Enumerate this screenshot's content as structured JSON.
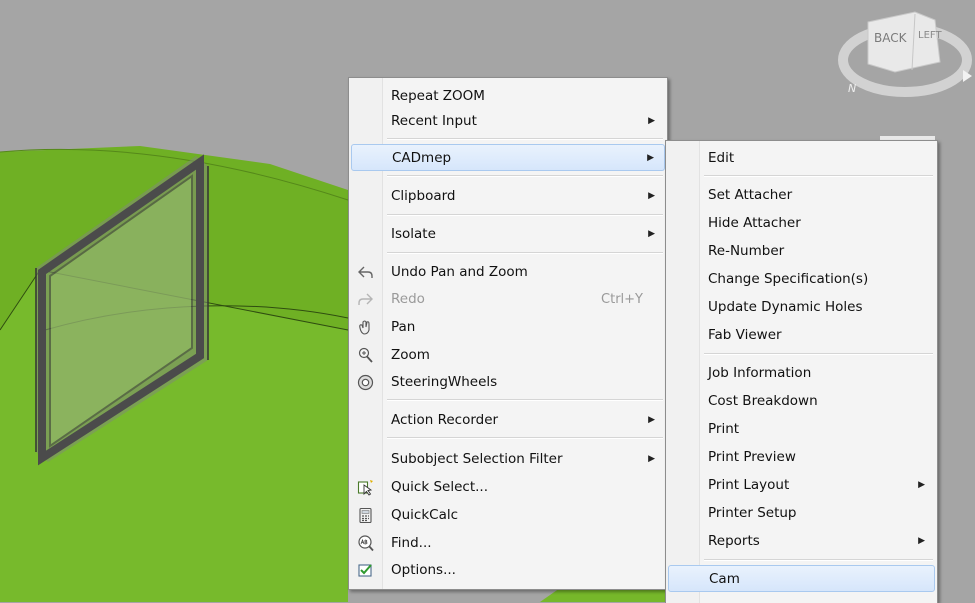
{
  "viewcube": {
    "face_back": "BACK",
    "face_left": "LEFT",
    "compass_n": "N"
  },
  "context_menu": {
    "items": [
      {
        "label": "Repeat ZOOM"
      },
      {
        "label": "Recent Input"
      },
      {
        "label": "CADmep"
      },
      {
        "label": "Clipboard"
      },
      {
        "label": "Isolate"
      },
      {
        "label": "Undo Pan and Zoom",
        "icon": "undo-icon"
      },
      {
        "label": "Redo",
        "icon": "redo-icon",
        "shortcut": "Ctrl+Y",
        "disabled": true
      },
      {
        "label": "Pan",
        "icon": "pan-hand-icon"
      },
      {
        "label": "Zoom",
        "icon": "zoom-magnifier-icon"
      },
      {
        "label": "SteeringWheels",
        "icon": "steering-wheel-icon"
      },
      {
        "label": "Action Recorder"
      },
      {
        "label": "Subobject Selection Filter"
      },
      {
        "label": "Quick Select...",
        "icon": "quick-select-icon"
      },
      {
        "label": "QuickCalc",
        "icon": "calculator-icon"
      },
      {
        "label": "Find...",
        "icon": "find-abc-icon"
      },
      {
        "label": "Options...",
        "icon": "options-checkbox-icon"
      }
    ]
  },
  "cadmep_submenu": {
    "items": [
      {
        "label": "Edit"
      },
      {
        "label": "Set Attacher"
      },
      {
        "label": "Hide Attacher"
      },
      {
        "label": "Re-Number"
      },
      {
        "label": "Change Specification(s)"
      },
      {
        "label": "Update Dynamic Holes"
      },
      {
        "label": "Fab Viewer"
      },
      {
        "label": "Job Information"
      },
      {
        "label": "Cost Breakdown"
      },
      {
        "label": "Print"
      },
      {
        "label": "Print Preview"
      },
      {
        "label": "Print Layout"
      },
      {
        "label": "Printer Setup"
      },
      {
        "label": "Reports"
      },
      {
        "label": "Cam"
      }
    ]
  },
  "colors": {
    "duct_green": "#76b82a",
    "background": "#a5a5a5",
    "highlight": "#d6e6fb"
  }
}
